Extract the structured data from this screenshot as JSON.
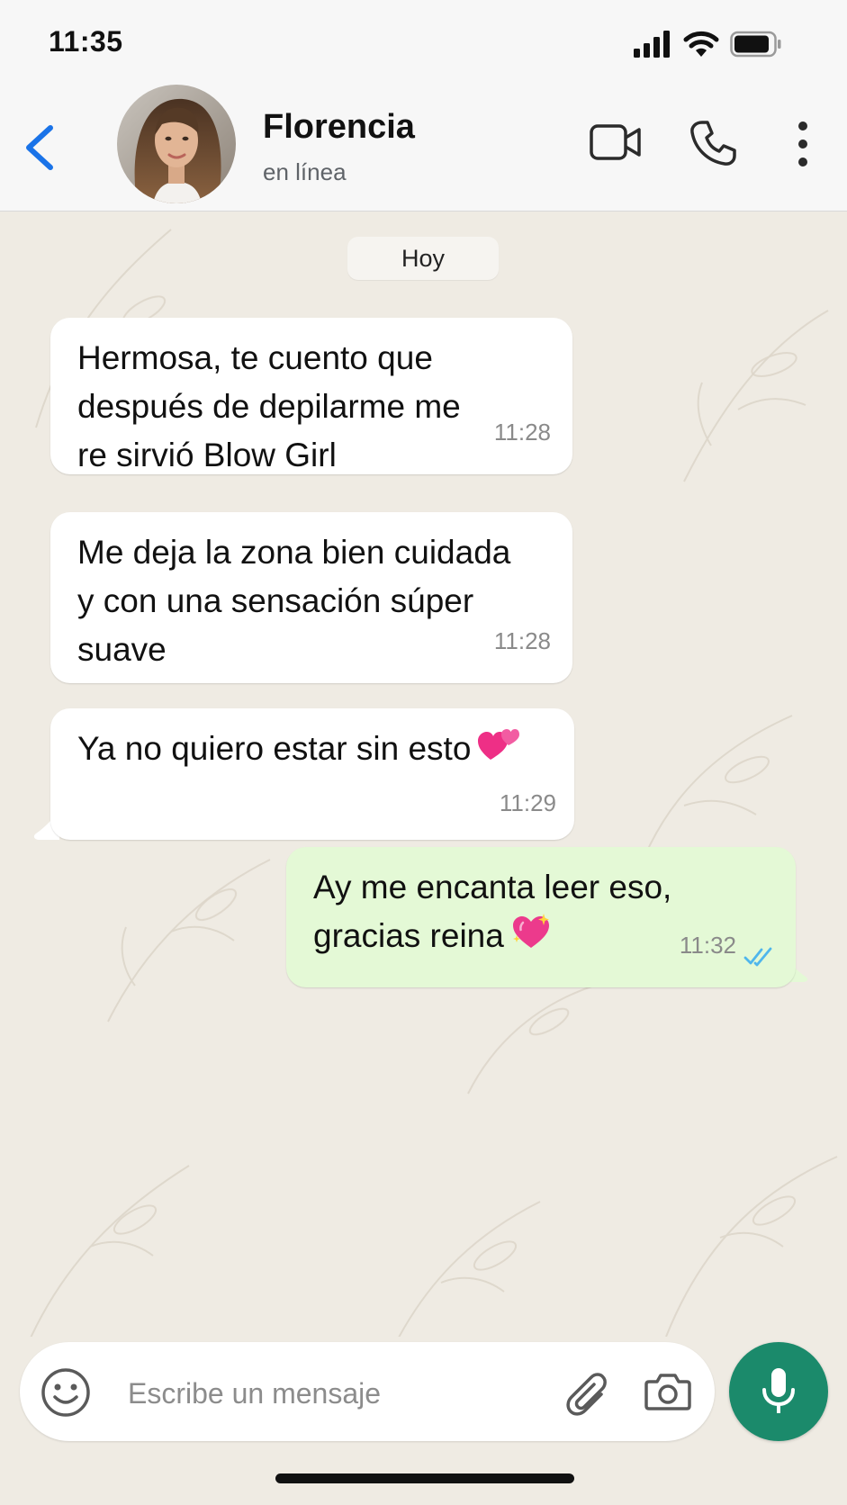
{
  "status_bar": {
    "time": "11:35"
  },
  "header": {
    "contact_name": "Florencia",
    "contact_status": "en línea"
  },
  "chat": {
    "date_divider": "Hoy",
    "messages": [
      {
        "direction": "incoming",
        "text": "Hermosa, te cuento que\ndespués de depilarme me\nre sirvió Blow Girl",
        "time": "11:28"
      },
      {
        "direction": "incoming",
        "text": "Me deja la zona bien cuidada\ny con una sensación súper\nsuave",
        "time": "11:28"
      },
      {
        "direction": "incoming",
        "text": "Ya no quiero estar sin esto",
        "emoji": "two-hearts",
        "time": "11:29"
      },
      {
        "direction": "outgoing",
        "text": "Ay me encanta leer eso,\ngracias reina",
        "emoji": "sparkling-heart",
        "time": "11:32",
        "read_status": "read"
      }
    ]
  },
  "composer": {
    "placeholder": "Escribe un mensaje"
  },
  "colors": {
    "accent_blue": "#1a73e8",
    "read_ticks": "#4fb6ec",
    "mic_green": "#1b8a6b",
    "outgoing_bubble": "#e4f9d6",
    "chat_background": "#efebe3"
  }
}
